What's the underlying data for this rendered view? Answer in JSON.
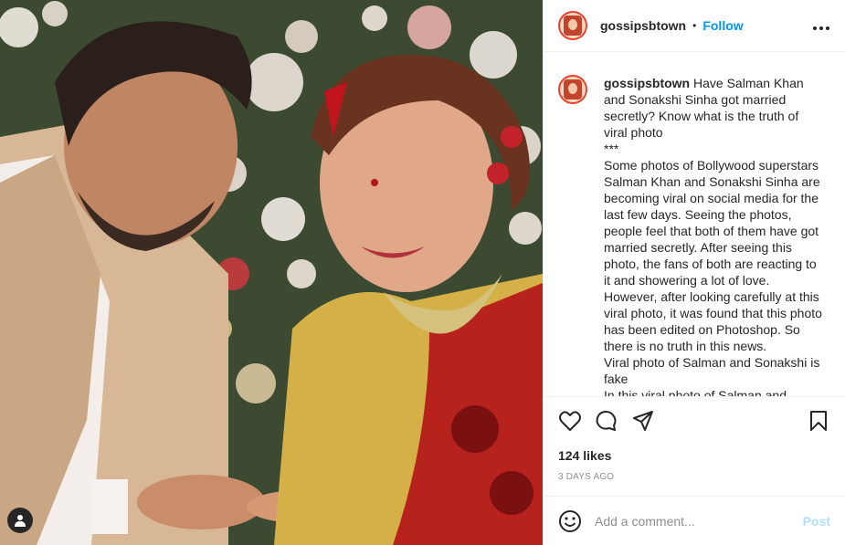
{
  "post": {
    "username": "gossipsbtown",
    "separator": "•",
    "follow_label": "Follow",
    "more_label": "•••"
  },
  "caption": {
    "username": "gossipsbtown",
    "text": " Have Salman Khan and Sonakshi Sinha got married secretly? Know what is the truth of viral photo\n***\nSome photos of Bollywood superstars Salman Khan and Sonakshi Sinha are becoming viral on social media for the last few days. Seeing the photos, people feel that both of them have got married secretly. After seeing this photo, the fans of both are reacting to it and showering a lot of love. However, after looking carefully at this viral photo, it was found that this photo has been edited on Photoshop. So there is no truth in this news.\nViral photo of Salman and Sonakshi is fake\nIn this viral photo of Salman and Sonakshi Sinha, there seems to be a ring"
  },
  "actions": {
    "likes": "124 likes",
    "time": "3 DAYS AGO"
  },
  "comment": {
    "placeholder": "Add a comment...",
    "post_label": "Post"
  },
  "icons": {
    "like": "heart-icon",
    "comment": "comment-bubble-icon",
    "share": "paper-plane-icon",
    "save": "bookmark-icon",
    "emoji": "smiley-icon",
    "user_tag": "person-icon"
  },
  "colors": {
    "follow": "#0095f6",
    "post_disabled": "#b2dffc",
    "avatar_ring": "#e8442f",
    "muted": "#8e8e8e"
  }
}
